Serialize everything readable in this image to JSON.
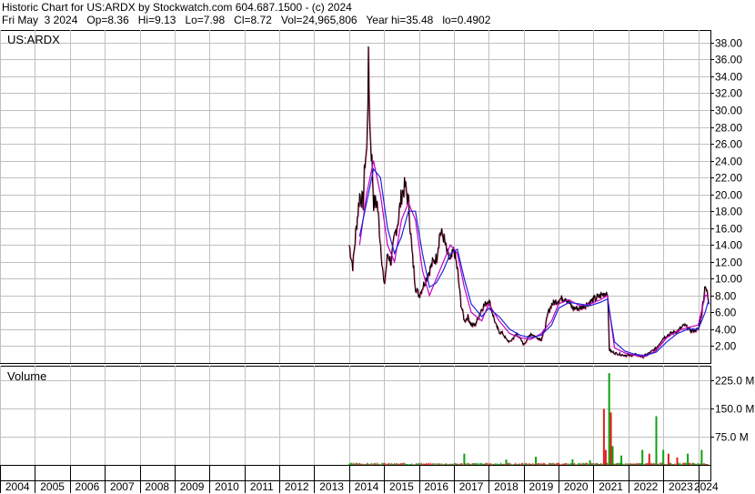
{
  "header": {
    "line1": "Historic Chart for US:ARDX by Stockwatch.com 604.687.1500 - (c) 2024",
    "line2": "Fri May  3 2024   Op=8.36   Hi=9.13   Lo=7.98   Cl=8.72   Vol=24,965,806   Year hi=35.48   lo=0.4902"
  },
  "chart_data": [
    {
      "type": "line",
      "panel": "price",
      "label": "US:ARDX",
      "grid": true,
      "ylim": [
        0,
        39.5
      ],
      "yticks": [
        "2.00",
        "4.00",
        "6.00",
        "8.00",
        "10.00",
        "12.00",
        "14.00",
        "16.00",
        "18.00",
        "20.00",
        "22.00",
        "24.00",
        "26.00",
        "28.00",
        "30.00",
        "32.00",
        "34.00",
        "36.00",
        "38.00"
      ],
      "xtick_labels": [
        "2004",
        "2005",
        "2006",
        "2007",
        "2008",
        "2009",
        "2010",
        "2011",
        "2012",
        "2013",
        "2014",
        "2015",
        "2016",
        "2017",
        "2018",
        "2019",
        "2020",
        "2021",
        "2022",
        "2023",
        "2024"
      ],
      "price_x": [
        2014.0,
        2014.1,
        2014.2,
        2014.3,
        2014.4,
        2014.45,
        2014.5,
        2014.55,
        2014.6,
        2014.65,
        2014.7,
        2014.8,
        2014.9,
        2015.0,
        2015.1,
        2015.2,
        2015.3,
        2015.4,
        2015.5,
        2015.6,
        2015.7,
        2015.8,
        2015.9,
        2016.0,
        2016.2,
        2016.4,
        2016.5,
        2016.6,
        2016.7,
        2016.8,
        2016.9,
        2017.0,
        2017.1,
        2017.2,
        2017.3,
        2017.4,
        2017.5,
        2017.6,
        2017.8,
        2018.0,
        2018.1,
        2018.2,
        2018.3,
        2018.4,
        2018.5,
        2018.6,
        2018.8,
        2019.0,
        2019.2,
        2019.4,
        2019.5,
        2019.6,
        2019.7,
        2019.8,
        2020.0,
        2020.2,
        2020.4,
        2020.6,
        2020.8,
        2021.0,
        2021.2,
        2021.4,
        2021.45,
        2021.5,
        2021.6,
        2021.8,
        2022.0,
        2022.2,
        2022.4,
        2022.6,
        2022.8,
        2023.0,
        2023.2,
        2023.4,
        2023.6,
        2023.8,
        2024.0,
        2024.1,
        2024.2,
        2024.3
      ],
      "price_y": [
        14,
        11.5,
        16,
        20,
        19,
        24,
        25,
        35.5,
        27,
        24,
        19,
        19,
        14,
        9,
        13,
        12,
        15,
        17,
        20,
        21,
        19,
        13,
        9,
        8,
        10,
        12,
        12.5,
        15.5,
        15,
        13,
        12,
        13.5,
        11,
        7,
        5,
        5.5,
        4.5,
        4.5,
        6.5,
        7.5,
        6,
        4.5,
        3.7,
        3.5,
        2.8,
        2.5,
        3.5,
        2.2,
        3.5,
        3,
        2.8,
        4,
        6,
        7,
        7.5,
        7.8,
        6.5,
        6.5,
        7,
        7.5,
        8,
        8.5,
        1.6,
        1.4,
        1.2,
        1,
        0.9,
        1,
        0.75,
        1.2,
        1.8,
        3,
        3.5,
        3.8,
        4.5,
        3.8,
        4,
        6,
        9.5,
        7
      ],
      "ma_blue_x": [
        2014.3,
        2014.5,
        2014.7,
        2014.9,
        2015.1,
        2015.3,
        2015.5,
        2015.7,
        2015.9,
        2016.1,
        2016.3,
        2016.5,
        2016.7,
        2016.9,
        2017.1,
        2017.3,
        2017.5,
        2017.8,
        2018.0,
        2018.3,
        2018.6,
        2018.9,
        2019.2,
        2019.5,
        2019.8,
        2020.0,
        2020.3,
        2020.6,
        2020.9,
        2021.2,
        2021.4,
        2021.6,
        2021.9,
        2022.2,
        2022.5,
        2022.8,
        2023.1,
        2023.4,
        2023.7,
        2024.0,
        2024.2,
        2024.3
      ],
      "ma_blue_y": [
        15,
        19,
        23,
        22,
        16,
        13,
        15,
        18,
        18,
        13,
        9,
        9.5,
        11,
        13,
        13.5,
        10,
        7,
        5.5,
        6.5,
        5.5,
        4,
        3.3,
        3,
        3.3,
        4.5,
        6.5,
        7.2,
        7,
        6.8,
        7.2,
        7.6,
        2.5,
        1.4,
        1,
        0.9,
        1.3,
        2.5,
        3.5,
        4,
        4,
        6,
        7.5
      ],
      "ma_purple_x": [
        2014.3,
        2014.5,
        2014.7,
        2014.9,
        2015.1,
        2015.3,
        2015.5,
        2015.7,
        2015.9,
        2016.1,
        2016.3,
        2016.5,
        2016.7,
        2016.9,
        2017.1,
        2017.3,
        2017.5,
        2017.8,
        2018.0,
        2018.3,
        2018.6,
        2018.9,
        2019.2,
        2019.5,
        2019.8,
        2020.0,
        2020.3,
        2020.6,
        2020.9,
        2021.2,
        2021.4,
        2021.6,
        2021.9,
        2022.2,
        2022.5,
        2022.8,
        2023.1,
        2023.4,
        2023.7,
        2024.0,
        2024.2,
        2024.3
      ],
      "ma_purple_y": [
        14,
        20,
        24,
        20,
        14,
        12,
        17,
        19,
        17,
        11,
        8,
        10,
        12,
        14,
        13,
        9,
        6,
        5,
        7,
        5,
        3.5,
        3,
        2.8,
        3.5,
        5,
        7,
        7.5,
        6.8,
        7,
        7.5,
        8,
        1.8,
        1.2,
        0.9,
        0.8,
        1.5,
        3,
        3.8,
        4.2,
        4.5,
        8,
        8
      ]
    },
    {
      "type": "bar",
      "panel": "volume",
      "label": "Volume",
      "grid": true,
      "ylim": [
        0,
        265
      ],
      "yticks": [
        "75.0 M",
        "150.0 M",
        "225.0 M"
      ],
      "spikes": [
        {
          "x": 2017.3,
          "value": 30,
          "color": "#10a010"
        },
        {
          "x": 2018.5,
          "value": 14,
          "color": "#10a010"
        },
        {
          "x": 2019.35,
          "value": 22,
          "color": "#10a010"
        },
        {
          "x": 2020.4,
          "value": 15,
          "color": "#10a010"
        },
        {
          "x": 2020.9,
          "value": 12,
          "color": "#10a010"
        },
        {
          "x": 2021.3,
          "value": 150,
          "color": "#e02020"
        },
        {
          "x": 2021.35,
          "value": 40,
          "color": "#e02020"
        },
        {
          "x": 2021.45,
          "value": 245,
          "color": "#10a010"
        },
        {
          "x": 2021.5,
          "value": 140,
          "color": "#e02020"
        },
        {
          "x": 2021.55,
          "value": 50,
          "color": "#10a010"
        },
        {
          "x": 2021.8,
          "value": 25,
          "color": "#10a010"
        },
        {
          "x": 2022.4,
          "value": 40,
          "color": "#10a010"
        },
        {
          "x": 2022.6,
          "value": 30,
          "color": "#e02020"
        },
        {
          "x": 2022.8,
          "value": 130,
          "color": "#10a010"
        },
        {
          "x": 2023.0,
          "value": 40,
          "color": "#10a010"
        },
        {
          "x": 2023.15,
          "value": 30,
          "color": "#e02020"
        },
        {
          "x": 2023.4,
          "value": 20,
          "color": "#e02020"
        },
        {
          "x": 2023.7,
          "value": 30,
          "color": "#10a010"
        },
        {
          "x": 2024.1,
          "value": 40,
          "color": "#10a010"
        }
      ]
    }
  ]
}
